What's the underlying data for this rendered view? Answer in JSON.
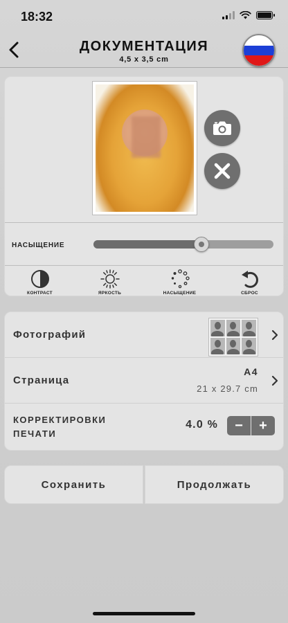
{
  "status_bar": {
    "time": "18:32"
  },
  "header": {
    "title": "ДОКУМЕНТАЦИЯ",
    "subtitle": "4,5 x 3,5 cm",
    "flag_colors": [
      "#ffffff",
      "#1c3fd6",
      "#e01818"
    ]
  },
  "photo_panel": {
    "saturation_label": "НАСЫЩЕНИЕ",
    "saturation_level": 0.6,
    "tools": [
      {
        "label": "КОНТРАСТ",
        "icon": "contrast-icon"
      },
      {
        "label": "ЯРКОСТЬ",
        "icon": "brightness-icon"
      },
      {
        "label": "НАСЫЩЕНИЕ",
        "icon": "saturation-icon"
      },
      {
        "label": "СБРОС",
        "icon": "reset-icon"
      }
    ]
  },
  "settings": {
    "photos_label": "Фотографий",
    "page_label": "Страница",
    "page_value": "A4",
    "page_size": "21 x 29.7 cm",
    "correction_label_line1": "КОРРЕКТИРОВКИ",
    "correction_label_line2": "ПЕЧАТИ",
    "correction_value": "4.0 %",
    "minus": "−",
    "plus": "+"
  },
  "actions": {
    "save": "Сохранить",
    "continue": "Продолжать"
  }
}
